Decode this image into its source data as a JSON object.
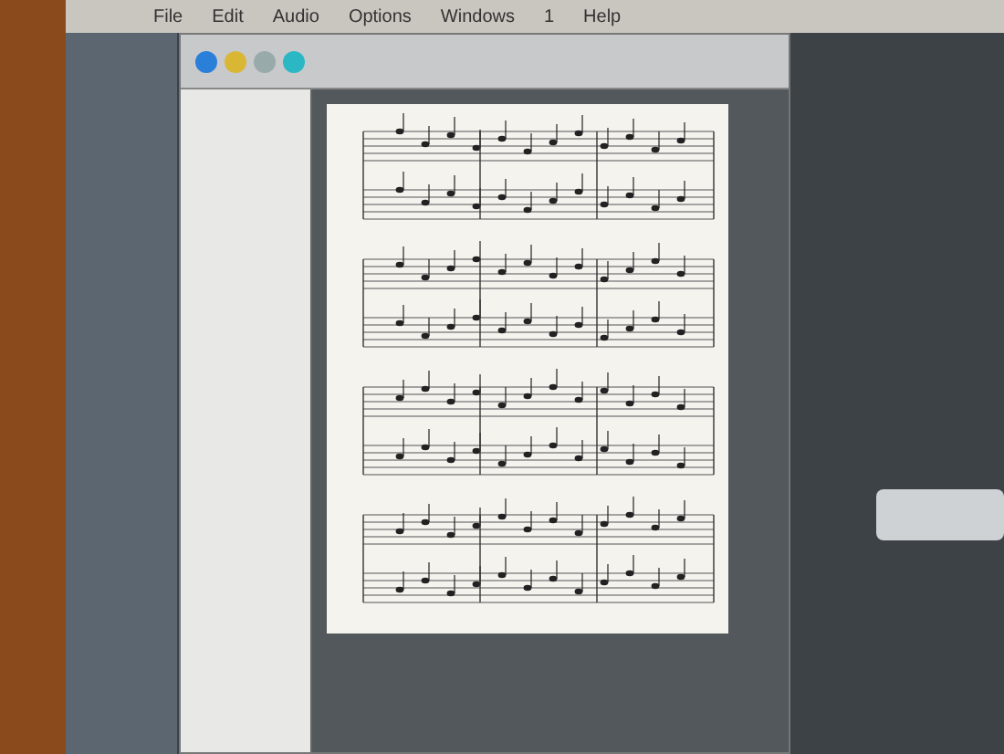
{
  "menu_bar": {
    "items": [
      {
        "label": "File"
      },
      {
        "label": "Edit"
      },
      {
        "label": "Audio"
      },
      {
        "label": "Options"
      },
      {
        "label": "Windows"
      },
      {
        "label": "1"
      },
      {
        "label": "Help"
      }
    ]
  }
}
